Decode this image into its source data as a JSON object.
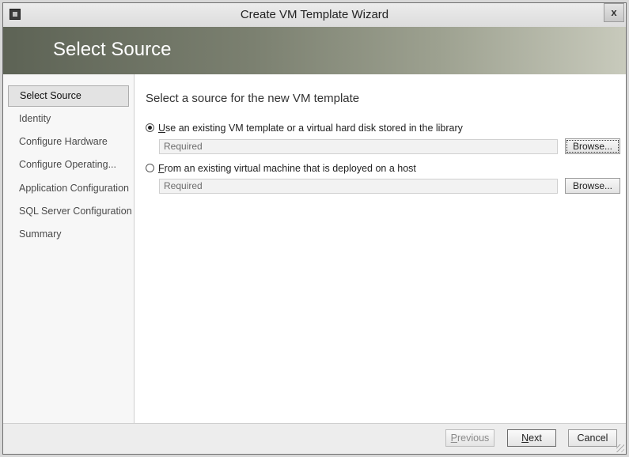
{
  "window": {
    "title": "Create VM Template Wizard",
    "close_label": "x"
  },
  "header": {
    "title": "Select Source"
  },
  "sidebar": {
    "items": [
      {
        "label": "Select Source",
        "active": true
      },
      {
        "label": "Identity",
        "active": false
      },
      {
        "label": "Configure Hardware",
        "active": false
      },
      {
        "label": "Configure Operating...",
        "active": false
      },
      {
        "label": "Application Configuration",
        "active": false
      },
      {
        "label": "SQL Server Configuration",
        "active": false
      },
      {
        "label": "Summary",
        "active": false
      }
    ]
  },
  "main": {
    "heading": "Select a source for the new VM template",
    "options": [
      {
        "mnemonic": "U",
        "label_rest": "se an existing VM template or a virtual hard disk stored in the library",
        "selected": true,
        "field_placeholder": "Required",
        "browse_label": "Browse..."
      },
      {
        "mnemonic": "F",
        "label_rest": "rom an existing virtual machine that is deployed on a host",
        "selected": false,
        "field_placeholder": "Required",
        "browse_label": "Browse..."
      }
    ]
  },
  "footer": {
    "previous": {
      "mnemonic": "P",
      "rest": "revious"
    },
    "next": {
      "mnemonic": "N",
      "rest": "ext"
    },
    "cancel_label": "Cancel"
  },
  "icons": [
    "window-app-icon",
    "close-icon",
    "radio-icon",
    "resize-grip-icon"
  ]
}
